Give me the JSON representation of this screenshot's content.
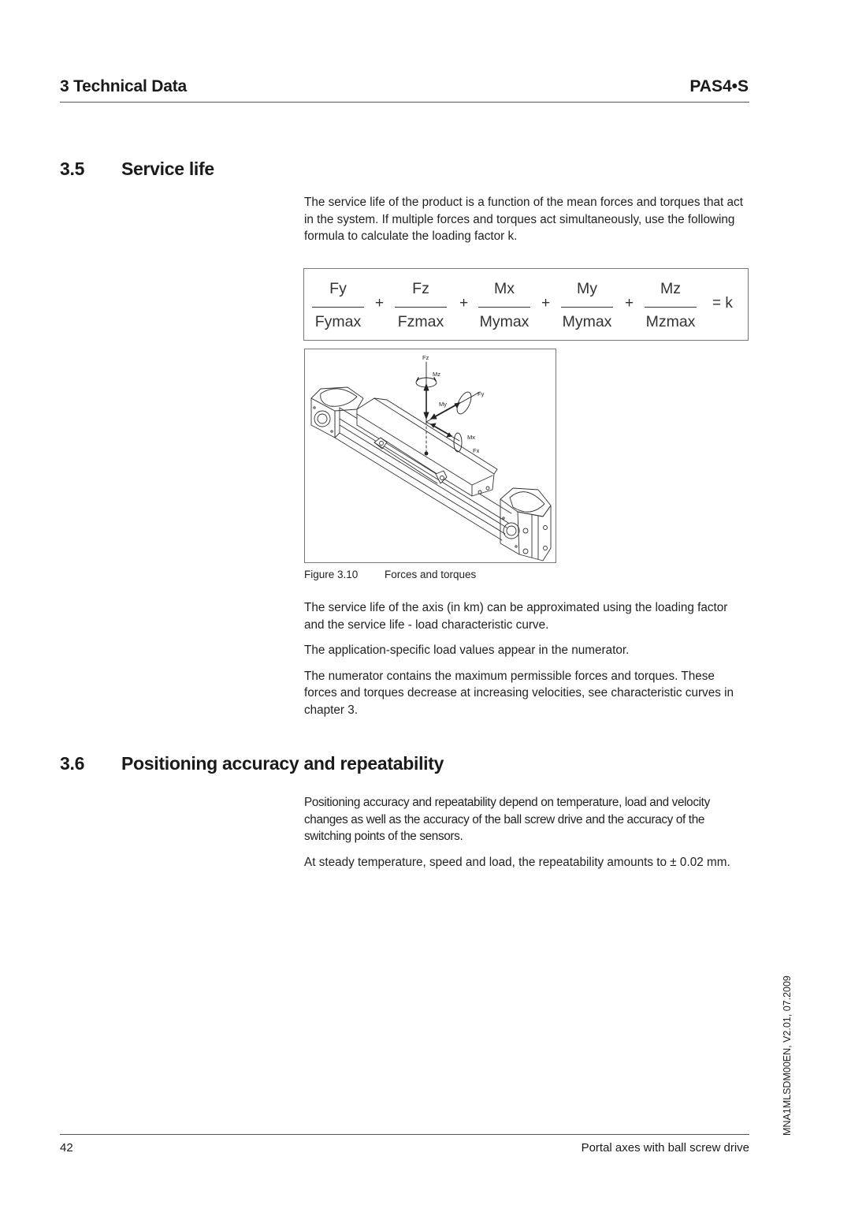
{
  "header": {
    "chapter": "3 Technical Data",
    "product": "PAS4•S"
  },
  "section_3_5": {
    "number": "3.5",
    "title": "Service life",
    "intro": "The service life of the product is a function of the mean forces and torques that act in the system. If multiple forces and torques act simultaneously, use the following formula to calculate the loading factor k.",
    "formula": {
      "terms": [
        {
          "numerator": "Fy",
          "denominator": "Fymax"
        },
        {
          "numerator": "Fz",
          "denominator": "Fzmax"
        },
        {
          "numerator": "Mx",
          "denominator": "Mymax"
        },
        {
          "numerator": "My",
          "denominator": "Mymax"
        },
        {
          "numerator": "Mz",
          "denominator": "Mzmax"
        }
      ],
      "plus": "+",
      "result": "= k"
    },
    "figure": {
      "labels": {
        "fz": "Fz",
        "mz": "Mz",
        "fy": "Fy",
        "my": "My",
        "mx": "Mx",
        "fx": "Fx"
      },
      "caption_number": "Figure 3.10",
      "caption_text": "Forces and torques"
    },
    "paragraphs": [
      "The service life of the axis (in km) can be approximated using the loading factor and the service life - load characteristic curve.",
      "The application-specific load values appear in the numerator.",
      "The numerator contains the maximum permissible forces and torques. These forces and torques decrease at increasing velocities, see characteristic curves in chapter 3."
    ]
  },
  "section_3_6": {
    "number": "3.6",
    "title": "Positioning accuracy and repeatability",
    "paragraphs": [
      "Positioning accuracy and repeatability depend on temperature, load and velocity changes as well as the accuracy of the ball screw drive and the accuracy of the switching points of the sensors.",
      "At steady temperature, speed and load, the repeatability amounts to ± 0.02 mm."
    ]
  },
  "side_id": "MNA1MLSDM00EN, V2.01, 07.2009",
  "footer": {
    "page_number": "42",
    "doc_title": "Portal axes with ball screw drive"
  }
}
